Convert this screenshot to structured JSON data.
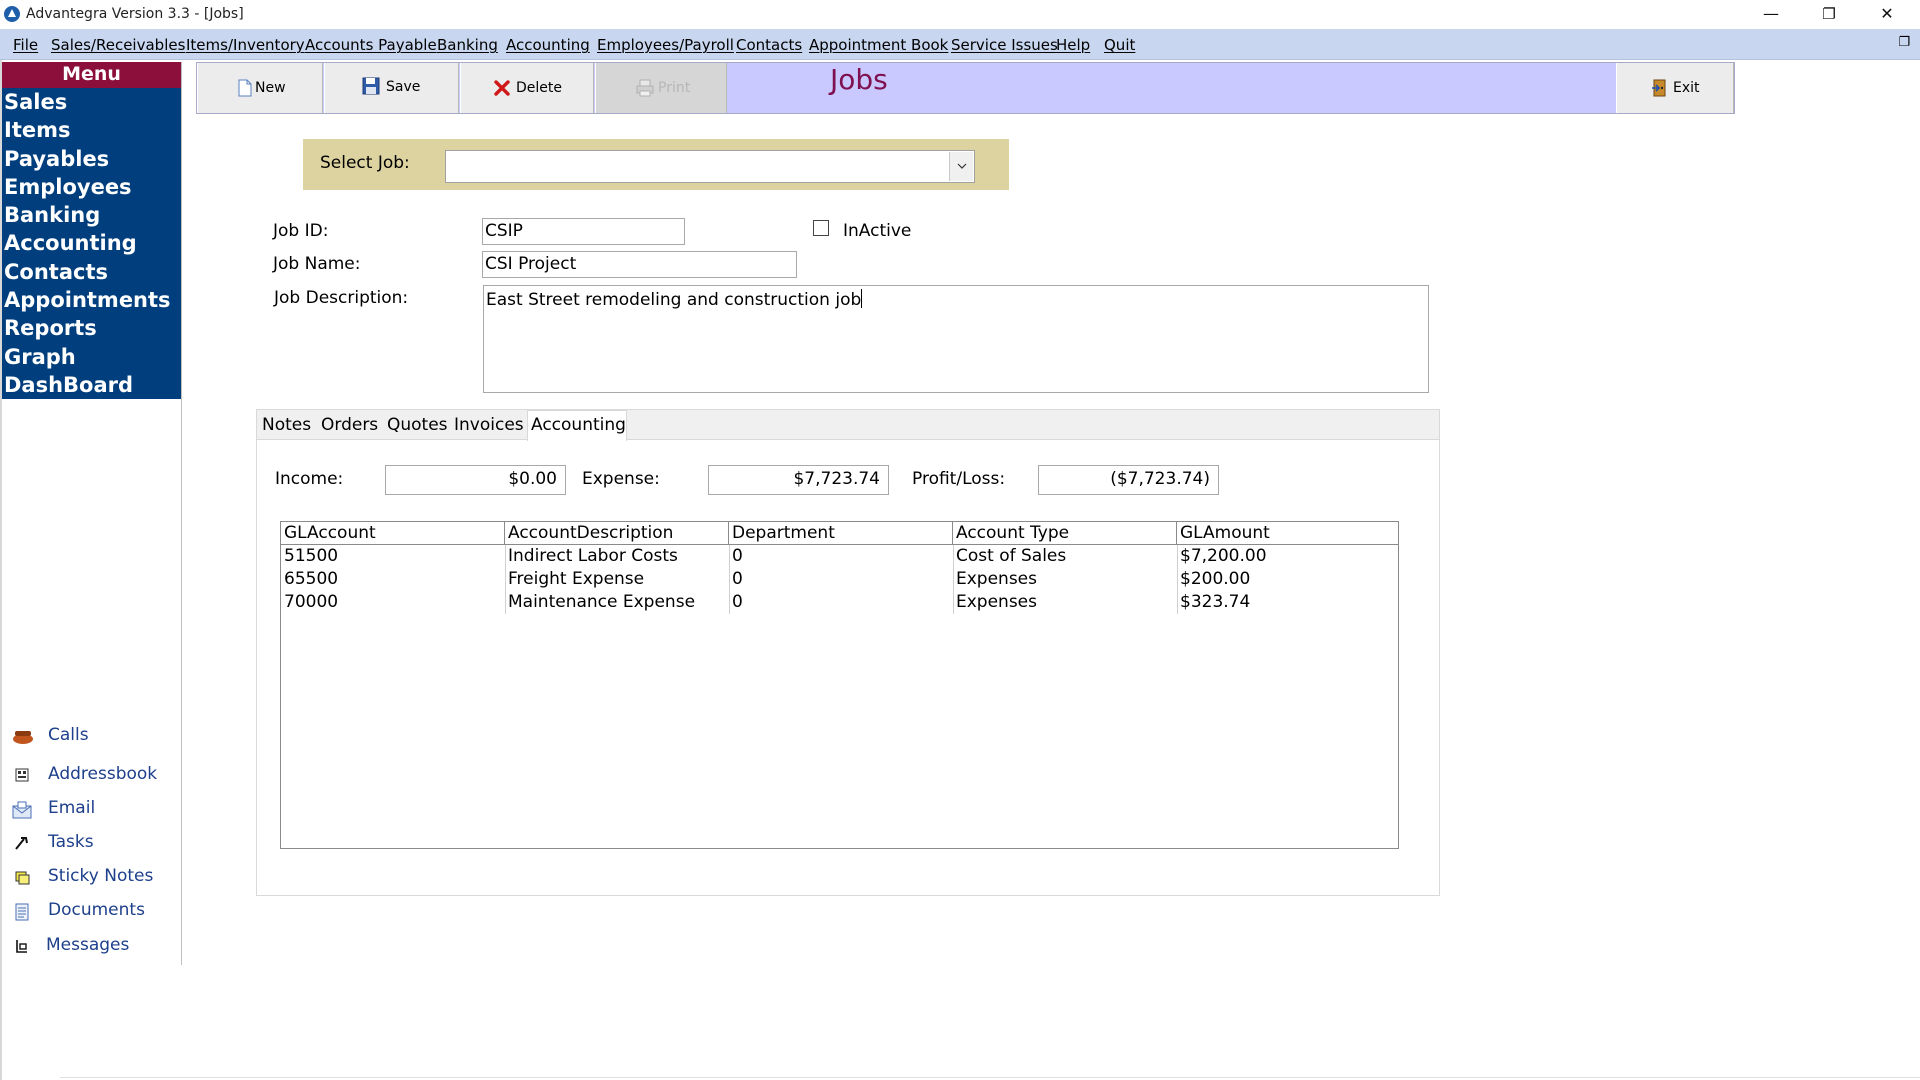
{
  "window": {
    "title": "Advantegra Version 3.3 - [Jobs]",
    "minimize": "—",
    "maximize": "❐",
    "close": "✕",
    "mdi_restore": "❐"
  },
  "menubar": [
    "File",
    "Sales/Receivables",
    "Items/Inventory",
    "Accounts Payable",
    "Banking",
    "Accounting",
    "Employees/Payroll",
    "Contacts",
    "Appointment Book",
    "Service Issues",
    "Help",
    "Quit"
  ],
  "nav": {
    "header": "Menu",
    "items": [
      "Sales",
      "Items",
      "Payables",
      "Employees",
      "Banking",
      "Accounting",
      "Contacts",
      "Appointments",
      "Reports",
      "Graph",
      "DashBoard"
    ]
  },
  "tools": [
    {
      "label": "Calls",
      "icon": "phone-icon"
    },
    {
      "label": "Addressbook",
      "icon": "addressbook-icon"
    },
    {
      "label": "Email",
      "icon": "email-icon"
    },
    {
      "label": "Tasks",
      "icon": "tasks-icon"
    },
    {
      "label": "Sticky Notes",
      "icon": "sticky-notes-icon"
    },
    {
      "label": "Documents",
      "icon": "documents-icon"
    },
    {
      "label": "Messages",
      "icon": "messages-icon"
    }
  ],
  "toolbar": {
    "new_label": "New",
    "save_label": "Save",
    "delete_label": "Delete",
    "print_label": "Print",
    "exit_label": "Exit"
  },
  "page_title": "Jobs",
  "select_job": {
    "label": "Select Job:",
    "value": ""
  },
  "form": {
    "job_id_label": "Job ID:",
    "job_id": "CSIP",
    "inactive_label": "InActive",
    "inactive_checked": false,
    "job_name_label": "Job Name:",
    "job_name": "CSI Project",
    "job_desc_label": "Job Description:",
    "job_desc": "East Street remodeling and construction job"
  },
  "tabs": [
    "Notes",
    "Orders",
    "Quotes",
    "Invoices",
    "Accounting"
  ],
  "active_tab": "Accounting",
  "accounting": {
    "income_label": "Income:",
    "income": "$0.00",
    "expense_label": "Expense:",
    "expense": "$7,723.74",
    "profit_label": "Profit/Loss:",
    "profit": "($7,723.74)"
  },
  "grid": {
    "columns": [
      "GLAccount",
      "AccountDescription",
      "Department",
      "Account Type",
      "GLAmount"
    ],
    "rows": [
      [
        "51500",
        "Indirect Labor Costs",
        "0",
        "Cost of Sales",
        "$7,200.00"
      ],
      [
        "65500",
        "Freight Expense",
        "0",
        "Expenses",
        "$200.00"
      ],
      [
        "70000",
        "Maintenance Expense",
        "0",
        "Expenses",
        "$323.74"
      ]
    ]
  },
  "colors": {
    "menubar": "#c8d6ef",
    "nav_bg": "#003e7d",
    "nav_header": "#8b0f3a",
    "toolbar_bg": "#c9c9ff",
    "title_color": "#7f1150",
    "select_panel": "#dcd3a0"
  }
}
